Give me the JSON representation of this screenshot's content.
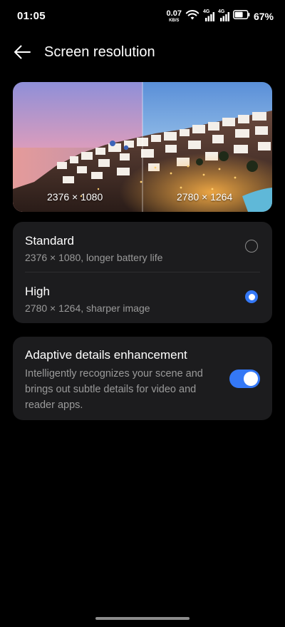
{
  "status_bar": {
    "time": "01:05",
    "net_speed_value": "0.07",
    "net_speed_unit": "KB/S",
    "signal_1_label": "4G",
    "signal_2_label": "4G",
    "battery_percent": "67%",
    "battery_level": 0.67
  },
  "header": {
    "title": "Screen resolution",
    "back_icon": "arrow-left-icon"
  },
  "preview": {
    "left_label": "2376 × 1080",
    "right_label": "2780 × 1264"
  },
  "resolution_options": [
    {
      "title": "Standard",
      "subtitle": "2376 × 1080, longer battery life",
      "selected": false
    },
    {
      "title": "High",
      "subtitle": "2780 × 1264, sharper image",
      "selected": true
    }
  ],
  "adaptive": {
    "title": "Adaptive details enhancement",
    "description": "Intelligently recognizes your scene and brings out subtle details for video and reader apps.",
    "enabled": true
  },
  "colors": {
    "accent": "#3478f6",
    "card_background": "#1c1c1e",
    "page_background": "#000000",
    "secondary_text": "#9a9a9a"
  }
}
